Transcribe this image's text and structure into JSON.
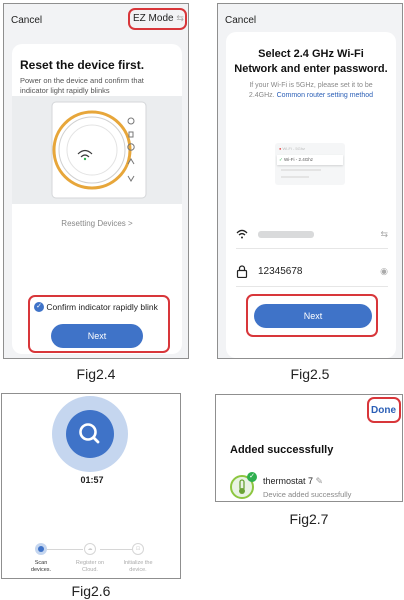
{
  "fig24": {
    "cancel": "Cancel",
    "mode_label": "EZ Mode",
    "mode_icon": "switch-arrows-icon",
    "title": "Reset the device first.",
    "description": "Power on the device and confirm that indicator light rapidly blinks",
    "resetting_link": "Resetting Devices",
    "resetting_chevron": ">",
    "confirm_label": "Confirm indicator rapidly blink",
    "confirm_checked": true,
    "next_label": "Next",
    "caption": "Fig2.4"
  },
  "fig25": {
    "cancel": "Cancel",
    "title_line1": "Select 2.4 GHz Wi-Fi",
    "title_line2": "Network and enter password.",
    "note_line1": "If your Wi-Fi is 5GHz, please set it to be",
    "note_line2_prefix": "2.4GHz.",
    "note_link": "Common router setting method",
    "illus_row1_left": "Wi-Fi - 5Ghz",
    "illus_row2_left": "Wi-Fi - 2.4Ghz",
    "ssid_value": "",
    "password_value": "12345678",
    "next_label": "Next",
    "caption": "Fig2.5"
  },
  "fig26": {
    "timer": "01:57",
    "steps": [
      {
        "label_line1": "Scan",
        "label_line2": "devices."
      },
      {
        "label_line1": "Register on",
        "label_line2": "Cloud."
      },
      {
        "label_line1": "Initialize the",
        "label_line2": "device."
      }
    ],
    "caption": "Fig2.6"
  },
  "fig27": {
    "done_label": "Done",
    "heading": "Added successfully",
    "device_name": "thermostat 7",
    "device_status": "Device added successfully",
    "caption": "Fig2.7"
  },
  "colors": {
    "accent": "#3f73c8",
    "highlight": "#d8363a",
    "success": "#2eaf4e",
    "link": "#2b5fb6"
  }
}
